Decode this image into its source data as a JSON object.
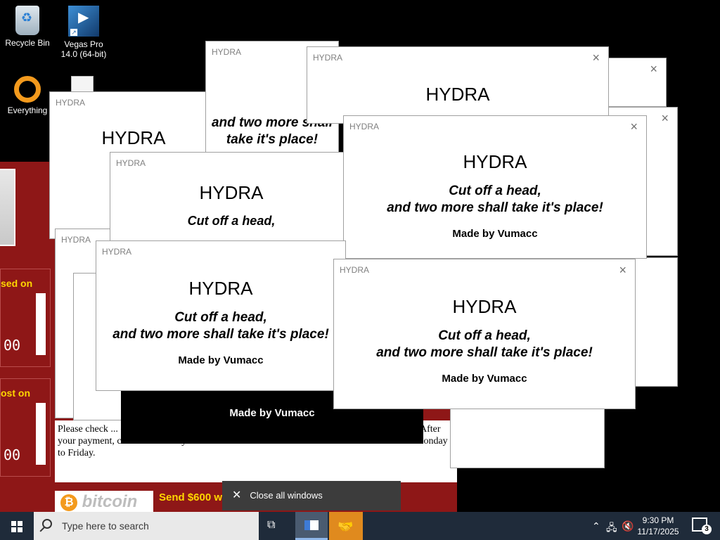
{
  "desktop": {
    "icons": [
      {
        "label": "Recycle Bin"
      },
      {
        "label": "Vegas Pro 14.0 (64-bit)"
      },
      {
        "label": "Everything"
      }
    ]
  },
  "ransom_window": {
    "label_lost_on_1": "sed on",
    "label_lost_on_2": "ost on",
    "timer_1": "00",
    "timer_2": "00",
    "instructions": "Please check ... click <How to buy bitcoins>. And send the correct amount to the address ... After your payment, click <Check Payment>. Best time to check: 9:00am - 11:00am GMT from Monday to Friday.",
    "bitcoin_label": "bitcoin",
    "send_label": "Send $600 w"
  },
  "hydra": {
    "title": "HYDRA",
    "heading": "HYDRA",
    "slogan_line1": "Cut off a head,",
    "slogan_line2": "and two more shall take it's place!",
    "made_by": "Made by Vumacc",
    "close_glyph": "×"
  },
  "popup": {
    "close_all_label": "Close all windows"
  },
  "taskbar": {
    "search_placeholder": "Type here to search",
    "time": "9:30 PM",
    "date": "11/17/2025",
    "notification_count": "3"
  }
}
